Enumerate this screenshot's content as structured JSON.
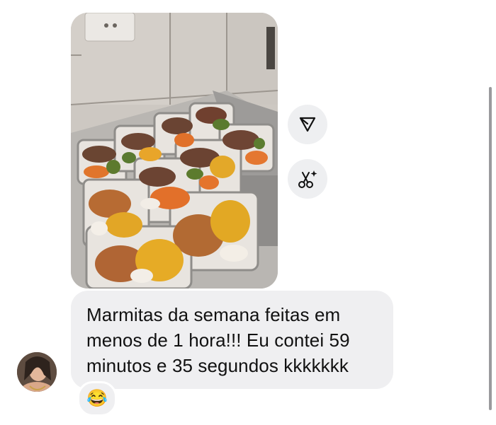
{
  "message": {
    "photo_icon": "food-photo",
    "text": "Marmitas da semana feitas em\nmenos de 1 hora!!! Eu contei 59\nminutos e 35 segundos kkkkkkk",
    "reaction_emoji": "😂"
  },
  "actions": {
    "send_icon": "send-icon",
    "ai_icon": "ai-scissors-icon"
  },
  "colors": {
    "bubble": "#efeff1",
    "button_bg": "#eeeff1",
    "text": "#111111"
  }
}
